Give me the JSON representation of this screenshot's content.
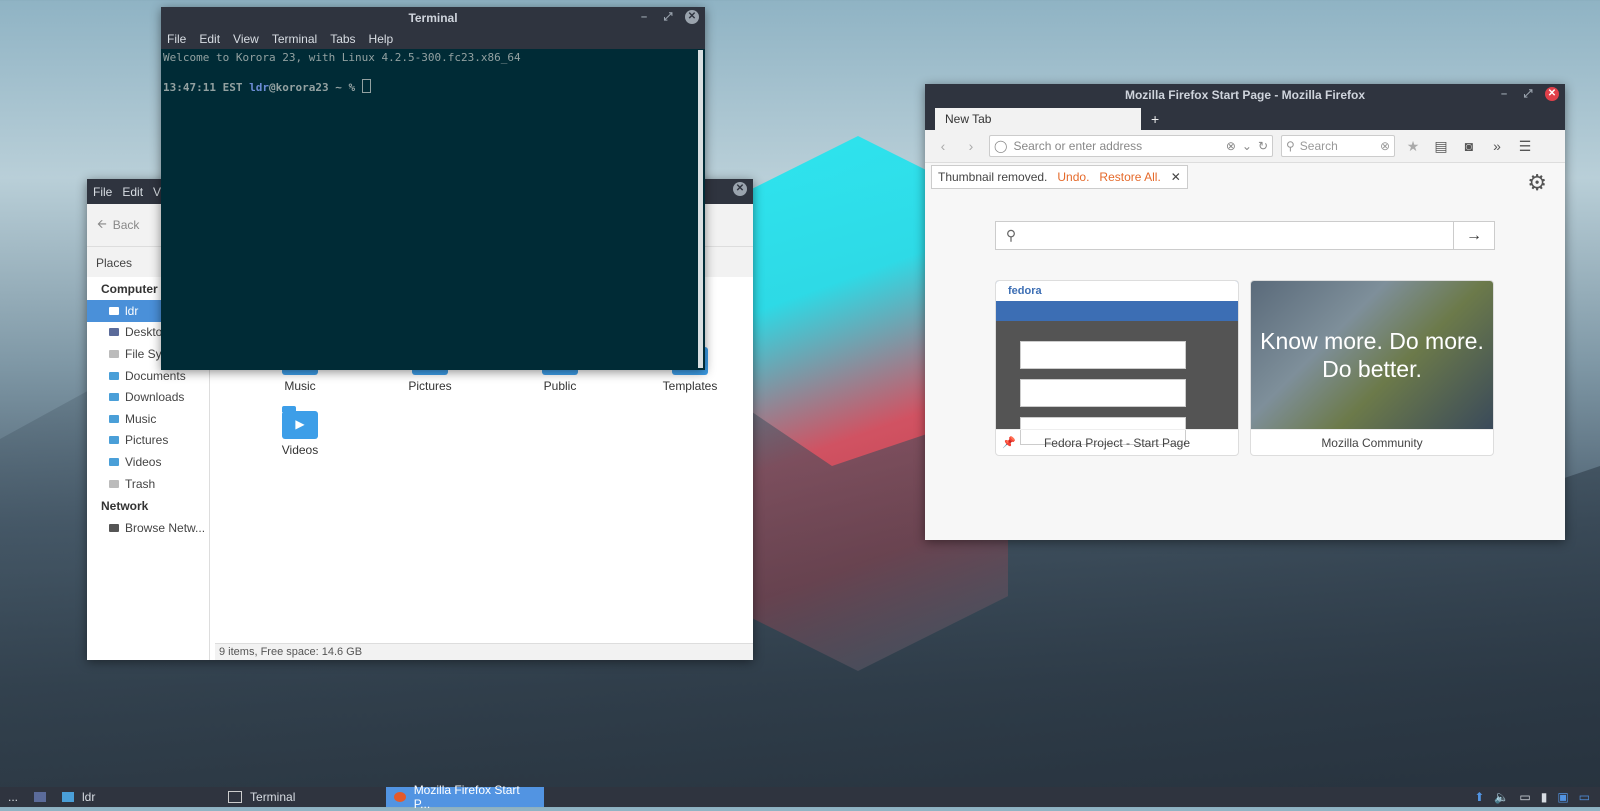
{
  "file_manager": {
    "menu": [
      "File",
      "Edit",
      "V"
    ],
    "back_label": "Back",
    "places_label": "Places",
    "sidebar": {
      "computer_header": "Computer",
      "items": [
        "ldr",
        "Desktop",
        "File System",
        "Documents",
        "Downloads",
        "Music",
        "Pictures",
        "Videos",
        "Trash"
      ],
      "network_header": "Network",
      "network_items": [
        "Browse Netw..."
      ]
    },
    "folders": [
      "Music",
      "Pictures",
      "Public",
      "Templates",
      "Videos"
    ],
    "status": "9 items, Free space: 14.6 GB"
  },
  "terminal": {
    "title": "Terminal",
    "menu": [
      "File",
      "Edit",
      "View",
      "Terminal",
      "Tabs",
      "Help"
    ],
    "welcome": "Welcome to Korora 23, with Linux 4.2.5-300.fc23.x86_64",
    "prompt_time": "13:47:11 EST",
    "prompt_user": "ldr",
    "prompt_host": "@korora23 ~ % "
  },
  "firefox": {
    "title": "Mozilla Firefox Start Page - Mozilla Firefox",
    "tab_label": "New Tab",
    "url_placeholder": "Search or enter address",
    "search_placeholder": "Search",
    "notification": {
      "text": "Thumbnail removed.",
      "undo": "Undo.",
      "restore": "Restore All."
    },
    "tiles": [
      {
        "title": "Fedora Project - Start Page",
        "brand": "fedora"
      },
      {
        "title": "Mozilla Community",
        "overlay": "Know more. Do more. Do better."
      }
    ]
  },
  "taskbar": {
    "menu_glyph": "...",
    "tasks": [
      {
        "label": "ldr",
        "active": false
      },
      {
        "label": "Terminal",
        "active": false
      },
      {
        "label": "Mozilla Firefox Start P...",
        "active": true
      }
    ]
  },
  "colors": {
    "accent": "#4a90d9",
    "titlebar": "#2f343f",
    "terminal_bg": "#002b36",
    "firefox_action": "#e56a2b"
  }
}
